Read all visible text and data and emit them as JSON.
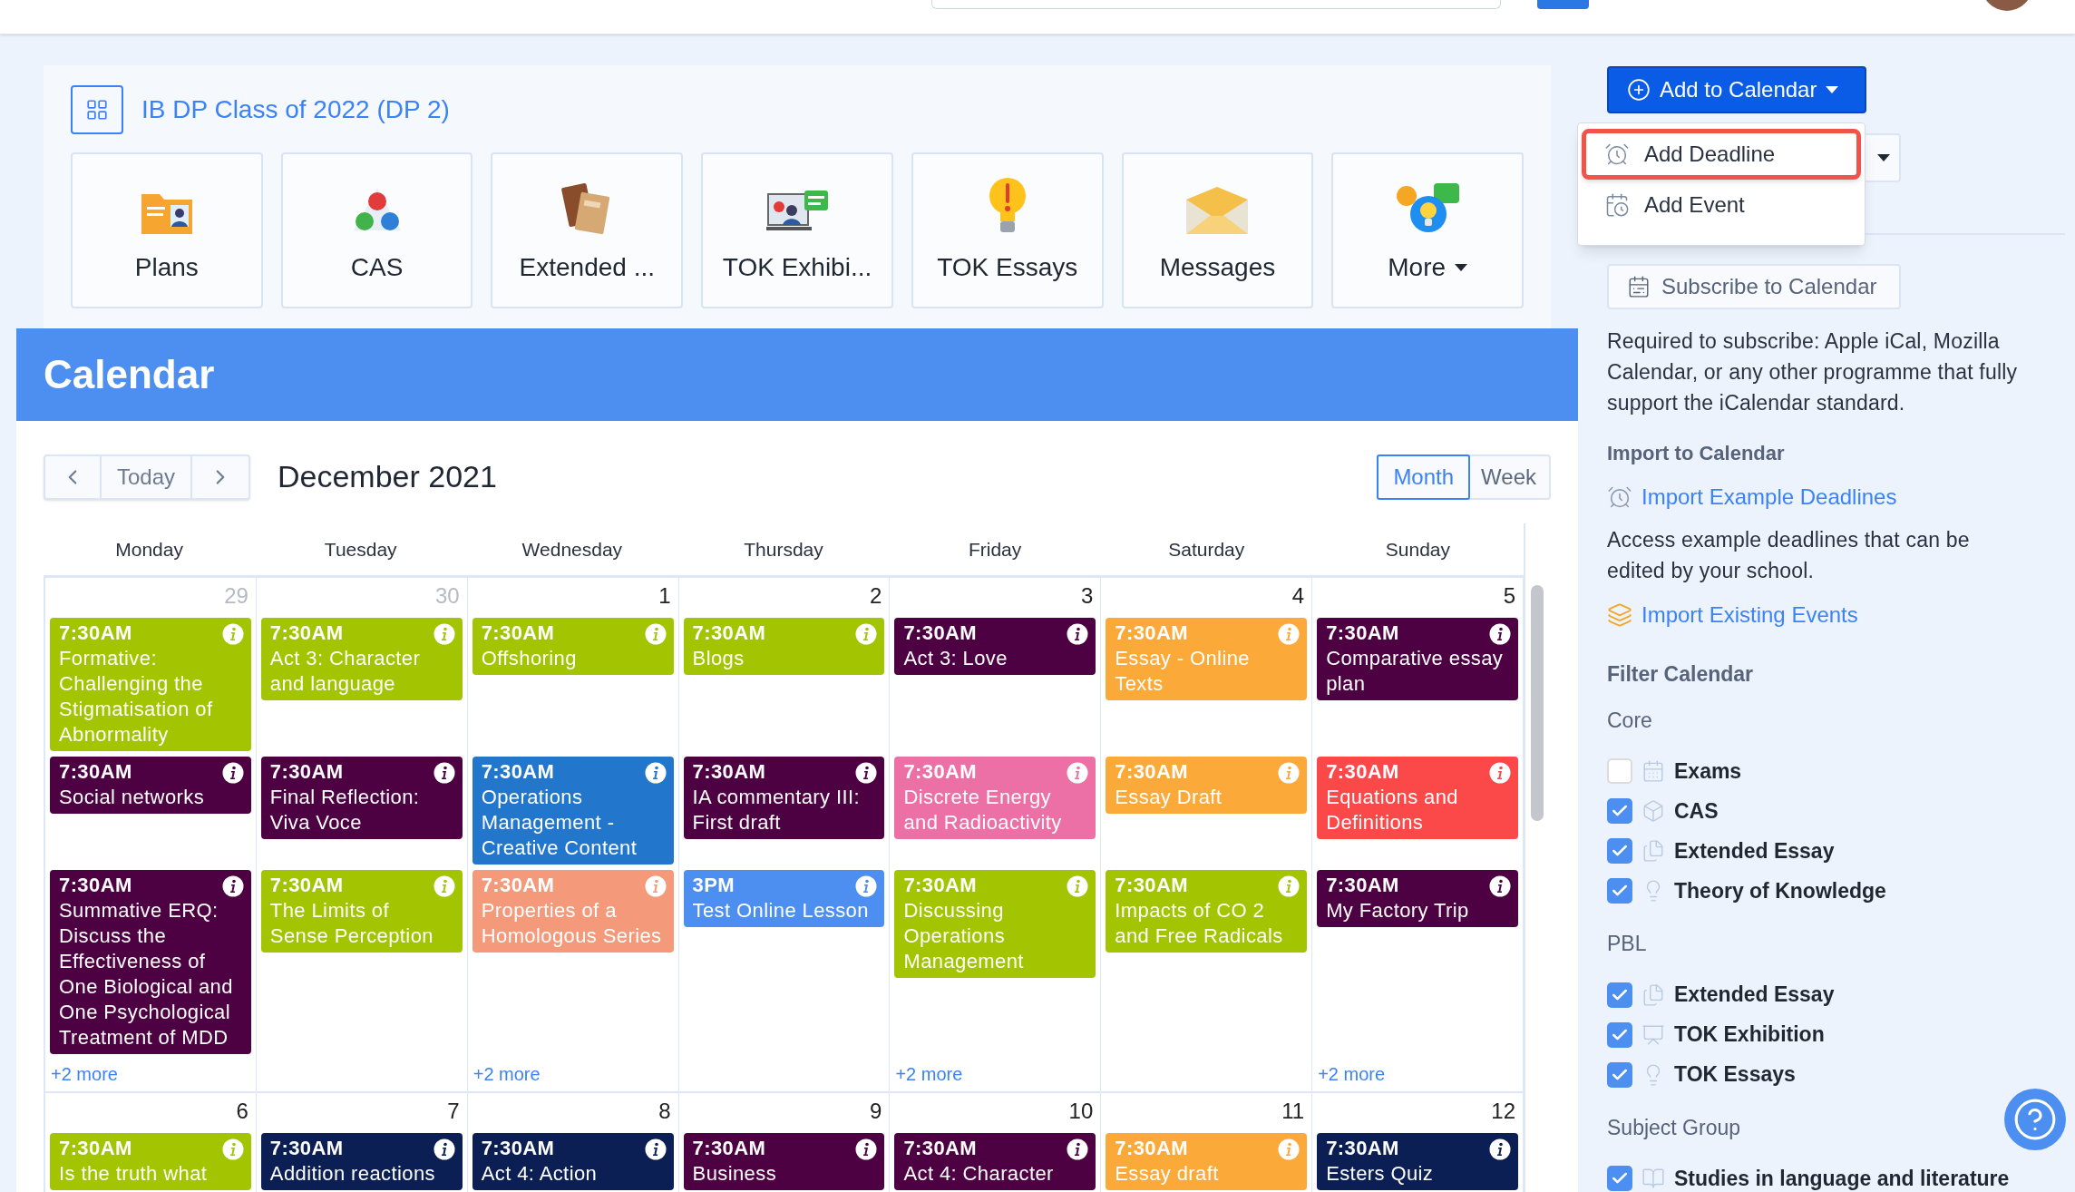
{
  "course": {
    "title": "IB DP Class of 2022 (DP 2)",
    "tiles": [
      {
        "label": "Plans",
        "kind": "link"
      },
      {
        "label": "CAS",
        "kind": "link"
      },
      {
        "label": "Extended ...",
        "kind": "link"
      },
      {
        "label": "TOK Exhibi...",
        "kind": "link"
      },
      {
        "label": "TOK Essays",
        "kind": "link"
      },
      {
        "label": "Messages",
        "kind": "link"
      },
      {
        "label": "More",
        "kind": "menu"
      }
    ]
  },
  "calendar": {
    "title": "Calendar",
    "today": "Today",
    "month_label": "December 2021",
    "views": [
      {
        "label": "Month",
        "selected": true
      },
      {
        "label": "Week",
        "selected": false
      }
    ],
    "weekdays": [
      "Monday",
      "Tuesday",
      "Wednesday",
      "Thursday",
      "Friday",
      "Saturday",
      "Sunday"
    ],
    "weeks": [
      {
        "days": [
          {
            "date": "29",
            "outside": true,
            "more": "+2 more",
            "events": [
              {
                "time": "7:30AM",
                "title": "Formative: Challenging the Stigmatisation of Abnormality",
                "color": "#a3c400"
              },
              {
                "time": "7:30AM",
                "title": "Social networks",
                "color": "#4d0042"
              },
              {
                "time": "7:30AM",
                "title": "Summative ERQ: Discuss the Effectiveness of One Biological and One Psychological Treatment of MDD",
                "color": "#4d0042"
              }
            ]
          },
          {
            "date": "30",
            "outside": true,
            "events": [
              {
                "time": "7:30AM",
                "title": "Act 3: Character and language",
                "color": "#a3c400"
              },
              {
                "time": "7:30AM",
                "title": "Final Reflection: Viva Voce",
                "color": "#4d0042"
              },
              {
                "time": "7:30AM",
                "title": "The Limits of Sense Perception",
                "color": "#a3c400"
              }
            ]
          },
          {
            "date": "1",
            "outside": false,
            "more": "+2 more",
            "events": [
              {
                "time": "7:30AM",
                "title": "Offshoring",
                "color": "#a3c400"
              },
              {
                "time": "7:30AM",
                "title": "Operations Management - Creative Content",
                "color": "#2277cc"
              },
              {
                "time": "7:30AM",
                "title": "Properties of a Homologous Series",
                "color": "#f4997a"
              }
            ]
          },
          {
            "date": "2",
            "outside": false,
            "events": [
              {
                "time": "7:30AM",
                "title": "Blogs",
                "color": "#a3c400"
              },
              {
                "time": "7:30AM",
                "title": "IA commentary III: First draft",
                "color": "#4d0042"
              },
              {
                "time": "3PM",
                "title": "Test Online Lesson",
                "color": "#4d8ff0"
              }
            ]
          },
          {
            "date": "3",
            "outside": false,
            "more": "+2 more",
            "events": [
              {
                "time": "7:30AM",
                "title": "Act 3: Love",
                "color": "#4d0042"
              },
              {
                "time": "7:30AM",
                "title": "Discrete Energy and Radioactivity",
                "color": "#ec6fa5"
              },
              {
                "time": "7:30AM",
                "title": "Discussing Operations Management",
                "color": "#a3c400"
              }
            ]
          },
          {
            "date": "4",
            "outside": false,
            "events": [
              {
                "time": "7:30AM",
                "title": "Essay - Online Texts",
                "color": "#fbaa3a"
              },
              {
                "time": "7:30AM",
                "title": "Essay Draft",
                "color": "#fbaa3a"
              },
              {
                "time": "7:30AM",
                "title": "Impacts of CO 2 and Free Radicals",
                "color": "#a3c400"
              }
            ]
          },
          {
            "date": "5",
            "outside": false,
            "more": "+2 more",
            "events": [
              {
                "time": "7:30AM",
                "title": "Comparative essay plan",
                "color": "#4d0042"
              },
              {
                "time": "7:30AM",
                "title": "Equations and Definitions",
                "color": "#fb4848"
              },
              {
                "time": "7:30AM",
                "title": "My Factory Trip",
                "color": "#4d0042"
              }
            ]
          }
        ]
      },
      {
        "days": [
          {
            "date": "6",
            "outside": false,
            "events": [
              {
                "time": "7:30AM",
                "title": "Is the truth what",
                "color": "#a3c400"
              }
            ]
          },
          {
            "date": "7",
            "outside": false,
            "events": [
              {
                "time": "7:30AM",
                "title": "Addition reactions",
                "color": "#0b1f55"
              }
            ]
          },
          {
            "date": "8",
            "outside": false,
            "events": [
              {
                "time": "7:30AM",
                "title": "Act 4: Action",
                "color": "#0b1f55"
              }
            ]
          },
          {
            "date": "9",
            "outside": false,
            "events": [
              {
                "time": "7:30AM",
                "title": "Business",
                "color": "#4d0042"
              }
            ]
          },
          {
            "date": "10",
            "outside": false,
            "events": [
              {
                "time": "7:30AM",
                "title": "Act 4: Character",
                "color": "#4d0042"
              }
            ]
          },
          {
            "date": "11",
            "outside": false,
            "events": [
              {
                "time": "7:30AM",
                "title": "Essay draft",
                "color": "#fbaa3a"
              }
            ]
          },
          {
            "date": "12",
            "outside": false,
            "events": [
              {
                "time": "7:30AM",
                "title": "Esters Quiz",
                "color": "#0b1f55"
              }
            ]
          }
        ]
      }
    ]
  },
  "side": {
    "add_button": "Add to Calendar",
    "menu": [
      {
        "label": "Add Deadline",
        "highlighted": true
      },
      {
        "label": "Add Event",
        "highlighted": false
      }
    ],
    "subscribe_button": "Subscribe to Calendar",
    "subscribe_note": "Required to subscribe: Apple iCal, Mozilla Calendar, or any other programme that fully support the iCalendar standard.",
    "import_heading": "Import to Calendar",
    "import_example_link": "Import Example Deadlines",
    "import_note": "Access example deadlines that can be edited by your school.",
    "import_existing_link": "Import Existing Events",
    "filter_heading": "Filter Calendar",
    "groups": [
      {
        "name": "Core",
        "items": [
          {
            "label": "Exams",
            "checked": false
          },
          {
            "label": "CAS",
            "checked": true
          },
          {
            "label": "Extended Essay",
            "checked": true
          },
          {
            "label": "Theory of Knowledge",
            "checked": true
          }
        ]
      },
      {
        "name": "PBL",
        "items": [
          {
            "label": "Extended Essay",
            "checked": true
          },
          {
            "label": "TOK Exhibition",
            "checked": true
          },
          {
            "label": "TOK Essays",
            "checked": true
          }
        ]
      },
      {
        "name": "Subject Group",
        "items": [
          {
            "label": "Studies in language and literature",
            "checked": true
          }
        ]
      }
    ]
  }
}
